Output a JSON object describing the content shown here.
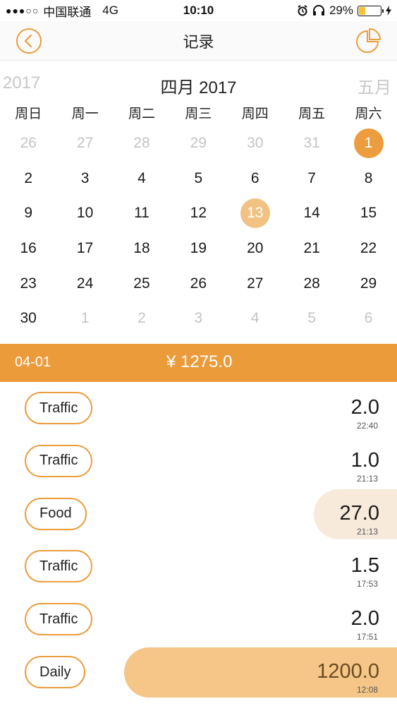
{
  "status_bar": {
    "signal": "●●●○○",
    "carrier": "中国联通",
    "network": "4G",
    "time": "10:10",
    "battery": "29%",
    "icons": [
      "alarm-icon",
      "headphones-icon",
      "battery-icon",
      "charging-icon"
    ]
  },
  "header": {
    "title": "记录",
    "back_icon": "back-icon",
    "chart_icon": "pie-chart-icon",
    "accent_color": "#ec9d3d"
  },
  "calendar": {
    "prev_label": "2017",
    "month_label": "四月 2017",
    "next_label": "五月",
    "weekdays": [
      "周日",
      "周一",
      "周二",
      "周三",
      "周四",
      "周五",
      "周六"
    ],
    "weeks": [
      [
        {
          "d": "26",
          "o": true
        },
        {
          "d": "27",
          "o": true
        },
        {
          "d": "28",
          "o": true
        },
        {
          "d": "29",
          "o": true
        },
        {
          "d": "30",
          "o": true
        },
        {
          "d": "31",
          "o": true
        },
        {
          "d": "1",
          "o": false,
          "selected": true
        }
      ],
      [
        {
          "d": "2"
        },
        {
          "d": "3"
        },
        {
          "d": "4"
        },
        {
          "d": "5"
        },
        {
          "d": "6"
        },
        {
          "d": "7"
        },
        {
          "d": "8"
        }
      ],
      [
        {
          "d": "9"
        },
        {
          "d": "10"
        },
        {
          "d": "11"
        },
        {
          "d": "12"
        },
        {
          "d": "13",
          "today": true
        },
        {
          "d": "14"
        },
        {
          "d": "15"
        }
      ],
      [
        {
          "d": "16"
        },
        {
          "d": "17"
        },
        {
          "d": "18"
        },
        {
          "d": "19"
        },
        {
          "d": "20"
        },
        {
          "d": "21"
        },
        {
          "d": "22"
        }
      ],
      [
        {
          "d": "23"
        },
        {
          "d": "24"
        },
        {
          "d": "25"
        },
        {
          "d": "26"
        },
        {
          "d": "27"
        },
        {
          "d": "28"
        },
        {
          "d": "29"
        }
      ],
      [
        {
          "d": "30"
        },
        {
          "d": "1",
          "o": true
        },
        {
          "d": "2",
          "o": true
        },
        {
          "d": "3",
          "o": true
        },
        {
          "d": "4",
          "o": true
        },
        {
          "d": "5",
          "o": true
        },
        {
          "d": "6",
          "o": true
        }
      ]
    ]
  },
  "summary": {
    "date": "04-01",
    "total": "¥ 1275.0"
  },
  "records": [
    {
      "category": "Traffic",
      "amount": "2.0",
      "time": "22:40",
      "share": 0.0016
    },
    {
      "category": "Traffic",
      "amount": "1.0",
      "time": "21:13",
      "share": 0.0008
    },
    {
      "category": "Food",
      "amount": "27.0",
      "time": "21:13",
      "share": 0.0212
    },
    {
      "category": "Traffic",
      "amount": "1.5",
      "time": "17:53",
      "share": 0.0012
    },
    {
      "category": "Traffic",
      "amount": "2.0",
      "time": "17:51",
      "share": 0.0016
    },
    {
      "category": "Daily",
      "amount": "1200.0",
      "time": "12:08",
      "share": 0.9412
    }
  ]
}
